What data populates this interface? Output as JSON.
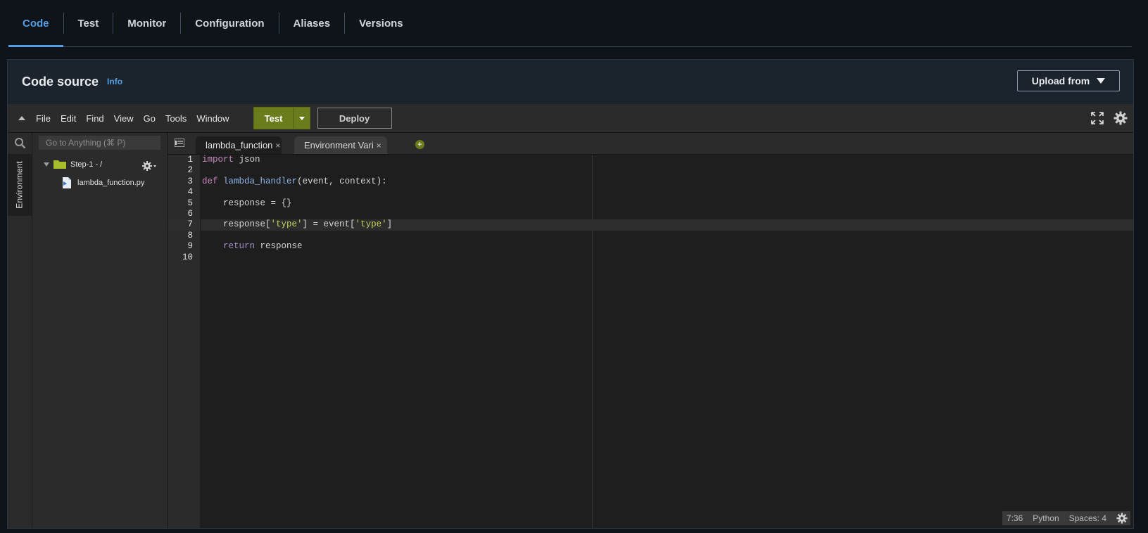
{
  "top_tabs": [
    {
      "label": "Code"
    },
    {
      "label": "Test"
    },
    {
      "label": "Monitor"
    },
    {
      "label": "Configuration"
    },
    {
      "label": "Aliases"
    },
    {
      "label": "Versions"
    }
  ],
  "panel": {
    "title": "Code source",
    "info": "Info",
    "upload_label": "Upload from"
  },
  "menu": {
    "items": [
      "File",
      "Edit",
      "Find",
      "View",
      "Go",
      "Tools",
      "Window"
    ],
    "test_label": "Test",
    "deploy_label": "Deploy"
  },
  "sidebar": {
    "environment_label": "Environment",
    "goto_placeholder": "Go to Anything (⌘ P)",
    "root_folder": "Step-1 - /",
    "file": "lambda_function.py"
  },
  "editor_tabs": [
    {
      "label": "lambda_function",
      "close": "×"
    },
    {
      "label": "Environment Vari",
      "close": "×"
    }
  ],
  "add_tab": "+",
  "code": {
    "line_numbers": [
      "1",
      "2",
      "3",
      "4",
      "5",
      "6",
      "7",
      "8",
      "9",
      "10"
    ],
    "lines": [
      "import json",
      "",
      "def lambda_handler(event, context):",
      "",
      "    response = {}",
      "",
      "    response['type'] = event['type']",
      "",
      "    return response",
      ""
    ],
    "highlighted_line": 7
  },
  "status": {
    "cursor": "7:36",
    "language": "Python",
    "indent": "Spaces: 4"
  },
  "colors": {
    "accent": "#539fe5",
    "test_button": "#6a7c1c"
  }
}
